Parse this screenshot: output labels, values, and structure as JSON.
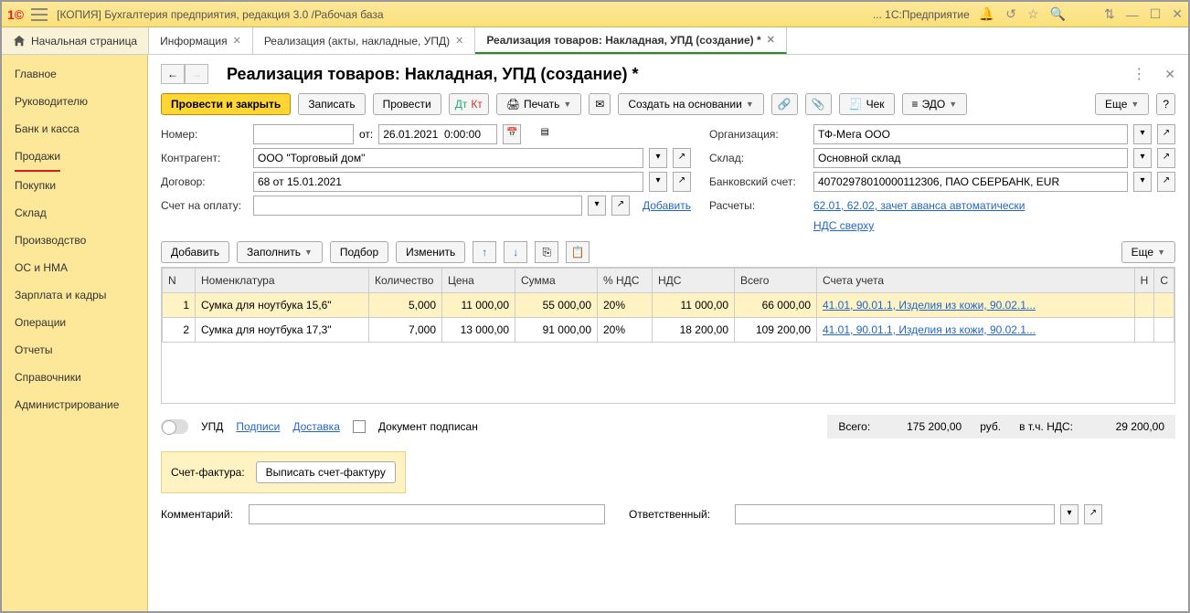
{
  "titlebar": {
    "title": "[КОПИЯ] Бухгалтерия предприятия, редакция 3.0 /Рабочая база",
    "right": "... 1С:Предприятие"
  },
  "tabs": {
    "start": "Начальная страница",
    "t1": "Информация",
    "t2": "Реализация (акты, накладные, УПД)",
    "t3": "Реализация товаров: Накладная, УПД (создание) *"
  },
  "sidebar": {
    "items": [
      "Главное",
      "Руководителю",
      "Банк и касса",
      "Продажи",
      "Покупки",
      "Склад",
      "Производство",
      "ОС и НМА",
      "Зарплата и кадры",
      "Операции",
      "Отчеты",
      "Справочники",
      "Администрирование"
    ]
  },
  "page": {
    "title": "Реализация товаров: Накладная, УПД (создание) *"
  },
  "toolbar": {
    "post_close": "Провести и закрыть",
    "write": "Записать",
    "post": "Провести",
    "print": "Печать",
    "create_on": "Создать на основании",
    "check": "Чек",
    "edo": "ЭДО",
    "more": "Еще"
  },
  "form": {
    "num_lbl": "Номер:",
    "from_lbl": "от:",
    "date_val": "26.01.2021  0:00:00",
    "org_lbl": "Организация:",
    "org_val": "ТФ-Мега ООО",
    "contr_lbl": "Контрагент:",
    "contr_val": "ООО \"Торговый дом\"",
    "sklad_lbl": "Склад:",
    "sklad_val": "Основной склад",
    "dogovor_lbl": "Договор:",
    "dogovor_val": "68 от 15.01.2021",
    "bank_lbl": "Банковский счет:",
    "bank_val": "40702978010000112306, ПАО СБЕРБАНК, EUR",
    "schet_lbl": "Счет на оплату:",
    "add_link": "Добавить",
    "rasch_lbl": "Расчеты:",
    "rasch_link": "62.01, 62.02, зачет аванса автоматически",
    "nds_link": "НДС сверху"
  },
  "row_toolbar": {
    "add": "Добавить",
    "fill": "Заполнить",
    "pick": "Подбор",
    "edit": "Изменить",
    "more": "Еще"
  },
  "table": {
    "headers": [
      "N",
      "Номенклатура",
      "Количество",
      "Цена",
      "Сумма",
      "% НДС",
      "НДС",
      "Всего",
      "Счета учета",
      "Н",
      "С"
    ],
    "rows": [
      {
        "n": "1",
        "name": "Сумка для ноутбука 15,6\"",
        "qty": "5,000",
        "price": "11 000,00",
        "sum": "55 000,00",
        "vatp": "20%",
        "vat": "11 000,00",
        "total": "66 000,00",
        "acc": "41.01, 90.01.1, Изделия из кожи, 90.02.1..."
      },
      {
        "n": "2",
        "name": "Сумка для ноутбука 17,3\"",
        "qty": "7,000",
        "price": "13 000,00",
        "sum": "91 000,00",
        "vatp": "20%",
        "vat": "18 200,00",
        "total": "109 200,00",
        "acc": "41.01, 90.01.1, Изделия из кожи, 90.02.1..."
      }
    ]
  },
  "footer": {
    "upd": "УПД",
    "sign": "Подписи",
    "delivery": "Доставка",
    "doc_signed": "Документ подписан",
    "total_lbl": "Всего:",
    "total_val": "175 200,00",
    "curr": "руб.",
    "vat_lbl": "в т.ч. НДС:",
    "vat_val": "29 200,00",
    "sf_lbl": "Счет-фактура:",
    "sf_btn": "Выписать счет-фактуру",
    "comment_lbl": "Комментарий:",
    "resp_lbl": "Ответственный:"
  }
}
